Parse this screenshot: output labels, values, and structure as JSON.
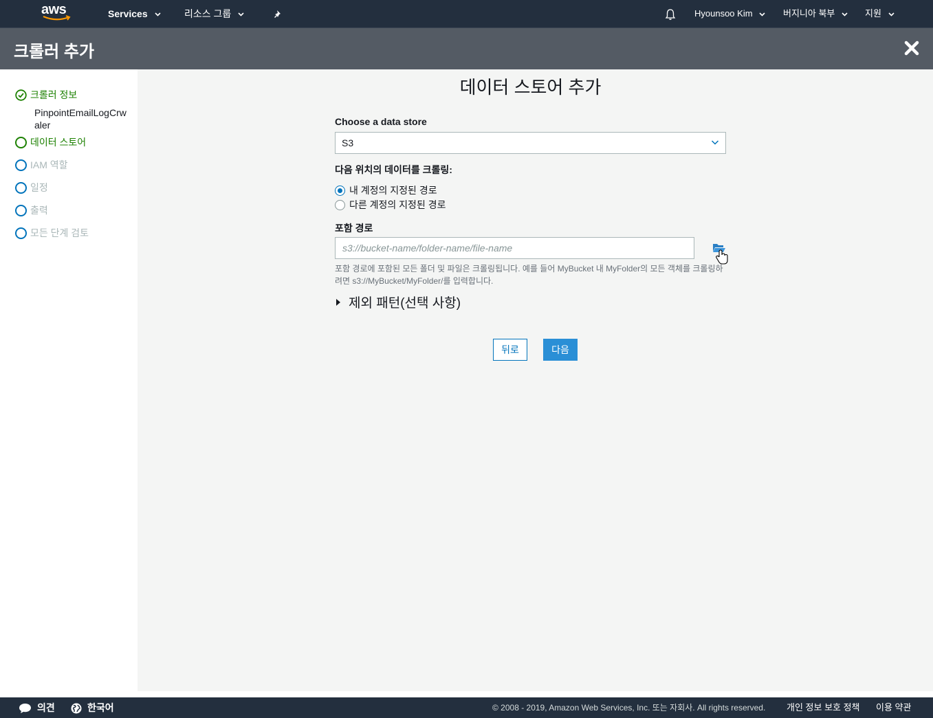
{
  "topnav": {
    "logo": "aws",
    "services": "Services",
    "resource_groups": "리소스 그룹",
    "pin_icon": "pushpin-icon",
    "bell_icon": "bell-icon",
    "user": "Hyounsoo Kim",
    "region": "버지니아 북부",
    "support": "지원"
  },
  "header": {
    "title": "크롤러 추가",
    "close_icon": "close-icon"
  },
  "sidebar": {
    "steps": [
      {
        "label": "크롤러 정보",
        "state": "done",
        "sub": "PinpointEmailLogCrwaler"
      },
      {
        "label": "데이터 스토어",
        "state": "active"
      },
      {
        "label": "IAM 역할",
        "state": "todo"
      },
      {
        "label": "일정",
        "state": "todo"
      },
      {
        "label": "출력",
        "state": "todo"
      },
      {
        "label": "모든 단계 검토",
        "state": "todo"
      }
    ]
  },
  "main": {
    "title": "데이터 스토어 추가",
    "data_store_label": "Choose a data store",
    "data_store_value": "S3",
    "crawl_label": "다음 위치의 데이터를 크롤링:",
    "radio_options": [
      {
        "label": "내 계정의 지정된 경로",
        "checked": true
      },
      {
        "label": "다른 계정의 지정된 경로",
        "checked": false
      }
    ],
    "include_path_label": "포함 경로",
    "include_path_value": "",
    "include_path_placeholder": "s3://bucket-name/folder-name/file-name",
    "help_text": "포함 경로에 포함된 모든 폴더 및 파일은 크롤링됩니다. 예를 들어 MyBucket 내 MyFolder의 모든 객체를 크롤링하려면 s3://MyBucket/MyFolder/를 입력합니다.",
    "exclude_patterns": "제외 패턴(선택 사항)",
    "back_button": "뒤로",
    "next_button": "다음"
  },
  "footer": {
    "feedback": "의견",
    "language": "한국어",
    "copyright": "© 2008 - 2019, Amazon Web Services, Inc. 또는 자회사. All rights reserved.",
    "privacy": "개인 정보 보호 정책",
    "terms": "이용 약관"
  },
  "colors": {
    "nav_bg": "#232f3e",
    "header_bg": "#545b64",
    "accent": "#0073bb",
    "success": "#1d8102",
    "primary_button": "#2a8fd6"
  }
}
